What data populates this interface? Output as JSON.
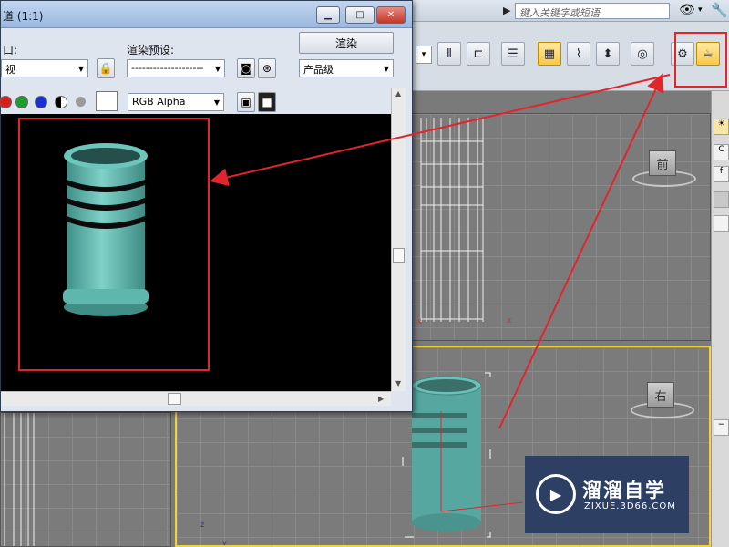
{
  "app": {
    "search_placeholder": "键入关键字或短语"
  },
  "dialog": {
    "title": "道 (1:1)",
    "viewport_label": "口:",
    "preset_label": "渲染预设:",
    "render_button": "渲染",
    "viewport_value": "视",
    "preset_value": "--------------------",
    "quality_value": "产品级",
    "channel_value": "RGB Alpha"
  },
  "viewports": {
    "front_cube_label": "前",
    "right_cube_label": "右",
    "axis_z": "z",
    "axis_y": "y"
  },
  "watermark": {
    "name": "溜溜自学",
    "url": "ZIXUE.3D66.COM"
  },
  "colors": {
    "highlight": "#e0262d",
    "object": "#5fb6ad",
    "active_viewport": "#f2d23a"
  }
}
